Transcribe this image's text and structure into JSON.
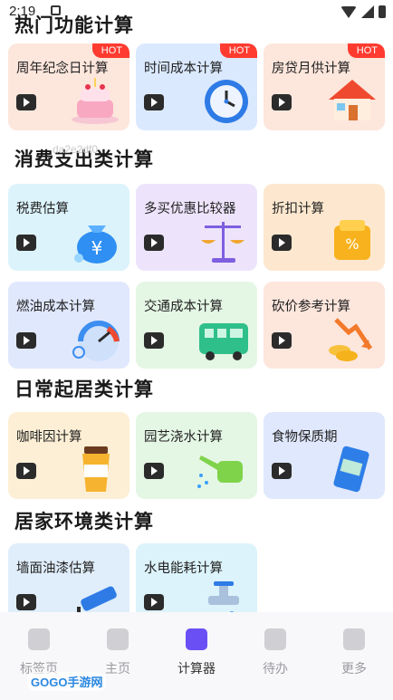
{
  "status_bar": {
    "time": "2:19"
  },
  "overlay_text": "da2e2df0",
  "sections": [
    {
      "title": "热门功能计算"
    },
    {
      "title": "消费支出类计算"
    },
    {
      "title": "日常起居类计算"
    },
    {
      "title": "居家环境类计算"
    }
  ],
  "hot_badge": "HOT",
  "cards": [
    {
      "label": "周年纪念日计算",
      "icon": "cake-icon",
      "hot": true
    },
    {
      "label": "时间成本计算",
      "icon": "clock-icon",
      "hot": true
    },
    {
      "label": "房贷月供计算",
      "icon": "house-icon",
      "hot": true
    },
    {
      "label": "税费估算",
      "icon": "money-bag-icon"
    },
    {
      "label": "多买优惠比较器",
      "icon": "scale-icon"
    },
    {
      "label": "折扣计算",
      "icon": "discount-box-icon"
    },
    {
      "label": "燃油成本计算",
      "icon": "fuel-gauge-icon"
    },
    {
      "label": "交通成本计算",
      "icon": "bus-icon"
    },
    {
      "label": "砍价参考计算",
      "icon": "coins-down-icon"
    },
    {
      "label": "咖啡因计算",
      "icon": "coffee-cup-icon"
    },
    {
      "label": "园艺浇水计算",
      "icon": "watering-can-icon"
    },
    {
      "label": "食物保质期",
      "icon": "food-package-icon"
    },
    {
      "label": "墙面油漆估算",
      "icon": "paint-roller-icon"
    },
    {
      "label": "水电能耗计算",
      "icon": "faucet-icon"
    }
  ],
  "tabbar": [
    {
      "label": "标签页",
      "icon": "tabs-icon"
    },
    {
      "label": "主页",
      "icon": "home-icon"
    },
    {
      "label": "计算器",
      "icon": "calculator-icon",
      "active": true
    },
    {
      "label": "待办",
      "icon": "bell-icon"
    },
    {
      "label": "更多",
      "icon": "more-icon"
    }
  ],
  "watermark": "GOGO手游网"
}
